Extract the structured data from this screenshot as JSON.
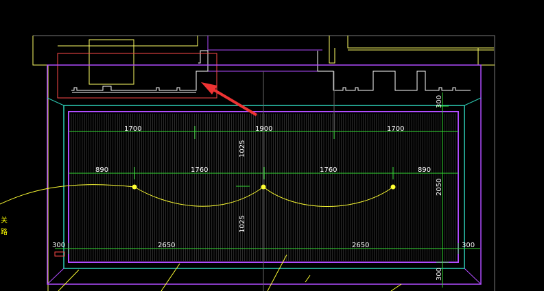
{
  "drawing": {
    "background": "#000000",
    "colors": {
      "wall_white": "#ffffff",
      "wall_yellow": "#ffff66",
      "outline_purple": "#b04cff",
      "room_cyan": "#2ecfb8",
      "dim_green": "#33dd33",
      "circuit_yellow": "#ffff33",
      "highlight_red": "#ff4a4a",
      "arrow_red": "#ee3333",
      "hatch_gray": "#9a9a9a"
    },
    "icons": [
      "arrow-pointer",
      "light-node",
      "section-marker"
    ]
  },
  "dimensions": {
    "top_row": [
      "1700",
      "1900",
      "1700"
    ],
    "middle_row": [
      "890",
      "1760",
      "1760",
      "890"
    ],
    "bottom_row": [
      "300",
      "2650",
      "2650",
      "300"
    ],
    "vertical_center": [
      "1025",
      "1025"
    ],
    "right_side": [
      "300",
      "2050",
      "300"
    ]
  },
  "labels": {
    "side_text_1": "关",
    "side_text_2": "路"
  }
}
